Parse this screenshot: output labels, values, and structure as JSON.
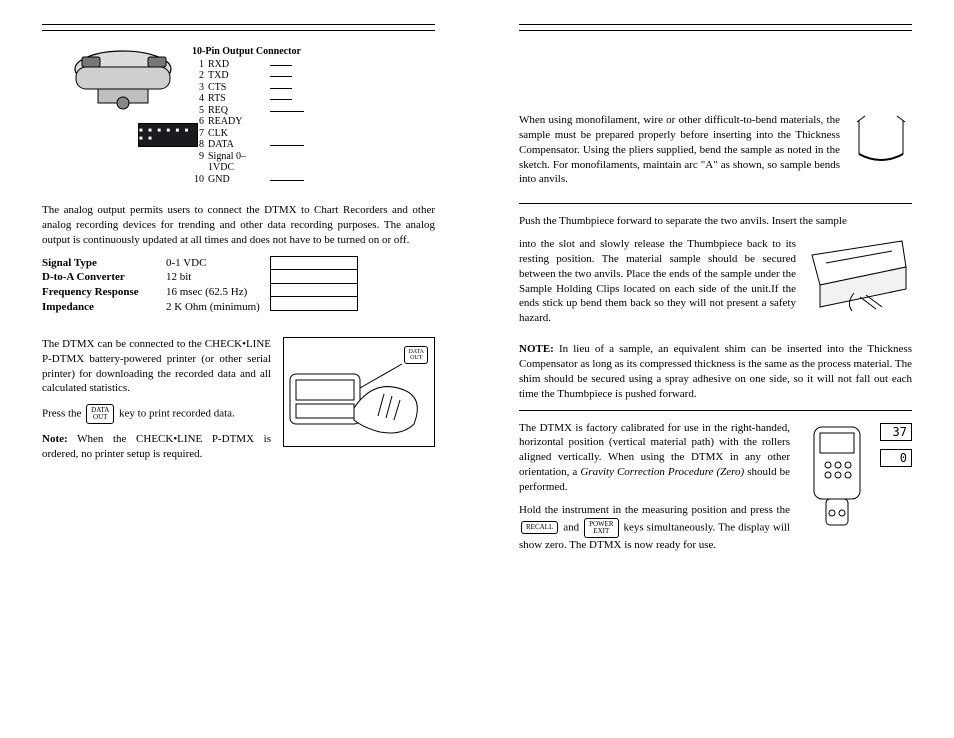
{
  "left": {
    "connector": {
      "title": "10-Pin Output Connector",
      "pins": [
        {
          "n": "1",
          "name": "RXD"
        },
        {
          "n": "2",
          "name": "TXD"
        },
        {
          "n": "3",
          "name": "CTS"
        },
        {
          "n": "4",
          "name": "RTS"
        },
        {
          "n": "5",
          "name": "REQ"
        },
        {
          "n": "6",
          "name": "READY"
        },
        {
          "n": "7",
          "name": "CLK"
        },
        {
          "n": "8",
          "name": "DATA"
        },
        {
          "n": "9",
          "name": "Signal 0–1VDC"
        },
        {
          "n": "10",
          "name": "GND"
        }
      ]
    },
    "analog_para": "The analog output permits users to connect the DTMX to Chart Recorders and other analog recording devices for trending and other data recording purposes. The analog output is continuously updated at all times and does not have to be turned on or off.",
    "specs": [
      {
        "label": "Signal Type",
        "value": "0-1 VDC"
      },
      {
        "label": "D-to-A Converter",
        "value": "12 bit"
      },
      {
        "label": "Frequency Response",
        "value": "16 msec (62.5 Hz)"
      },
      {
        "label": "Impedance",
        "value": "2 K Ohm (minimum)"
      }
    ],
    "printer_para": "The DTMX can be connected to the CHECK•LINE P-DTMX battery-powered printer (or other serial printer) for downloading the recorded data and all calculated statistics.",
    "press_pre": "Press the",
    "press_post": "key to print recorded data.",
    "press_key": "DATA\nOUT",
    "note_label": "Note:",
    "note_text": "When the CHECK•LINE P-DTMX is ordered, no printer setup is required.",
    "data_out_label": "DATA\nOUT"
  },
  "right": {
    "mono_para": "When using monofilament, wire or other difficult-to-bend materials, the sample must be prepared properly before inserting into the Thickness Compensator. Using the pliers supplied, bend the sample as noted in the sketch. For monofilaments, maintain arc \"A\" as shown, so sample bends into anvils.",
    "thumb_lead": "Push the Thumbpiece forward to separate the two anvils. Insert the sample",
    "thumb_para": "into the slot and slowly release the Thumbpiece back to its resting position. The material sample should be secured between the two anvils. Place the ends of the sample under the Sample Holding Clips located on each side of the unit.If the ends stick up bend them back so they will not present a safety hazard.",
    "note2_label": "NOTE:",
    "note2_text": "In lieu of a sample, an equivalent shim can be inserted into the Thickness Compensator as long as its compressed thickness is the same as the process material. The shim should be secured using a spray adhesive on one side, so it will not fall out each time the Thumbpiece is pushed forward.",
    "cal_para": "The DTMX is factory calibrated for use in the right-handed, horizontal position (vertical material path) with the rollers aligned vertically. When using the DTMX in any other orientation, a ",
    "cal_italic": "Gravity Correction Procedure (Zero)",
    "cal_para2": " should be performed.",
    "hold_pre": "Hold the instrument in the measuring position and press the",
    "hold_mid": "and",
    "hold_post": "keys simultaneously. The display will show zero. The DTMX is now ready for use.",
    "key_recall": "RECALL",
    "key_power": "POWER\nEXIT",
    "lcd_top": "37",
    "lcd_bot": "0"
  }
}
